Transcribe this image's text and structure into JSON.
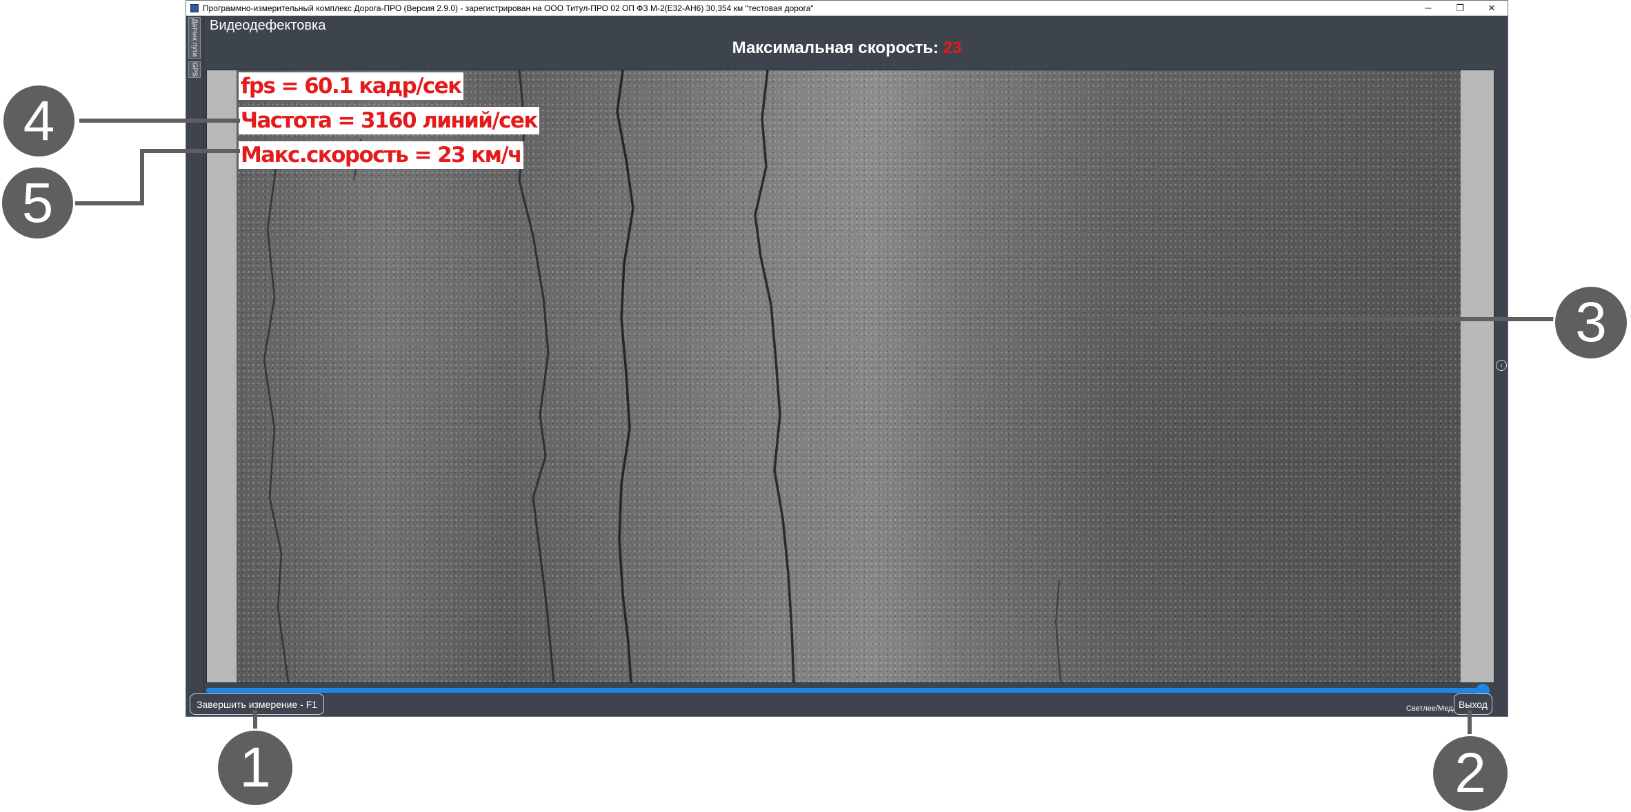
{
  "window": {
    "title": "Программно-измерительный комплекс Дорога-ПРО (Версия 2.9.0) - зарегистрирован на ООО Титул-ПРО 02 ОП ФЗ М-2(Е32-АН6) 30,354 км \"тестовая дорога\"",
    "minimize": "─",
    "restore": "❐",
    "close": "✕"
  },
  "side_tabs": [
    "Датчик пути",
    "GPS"
  ],
  "panel": {
    "title": "Видеодефектовка",
    "max_speed_label": "Максимальная скорость:",
    "max_speed_value": "23"
  },
  "video_overlay": {
    "fps": "fps = 60.1 кадр/сек",
    "frequency": "Частота = 3160 линий/сек",
    "max_speed": "Макс.скорость = 23 км/ч"
  },
  "progress": {
    "value": 1.0
  },
  "buttons": {
    "finish": "Завершить измерение - F1",
    "exit": "Выход"
  },
  "mode_label": "Светлее/Медленнее",
  "collapse_icon": "‹",
  "callouts": [
    "1",
    "2",
    "3",
    "4",
    "5"
  ],
  "colors": {
    "accent": "#1f86e8",
    "overlay_text": "#e31b1b",
    "panel_bg": "#3d444d",
    "callout": "#5f5f5f"
  }
}
